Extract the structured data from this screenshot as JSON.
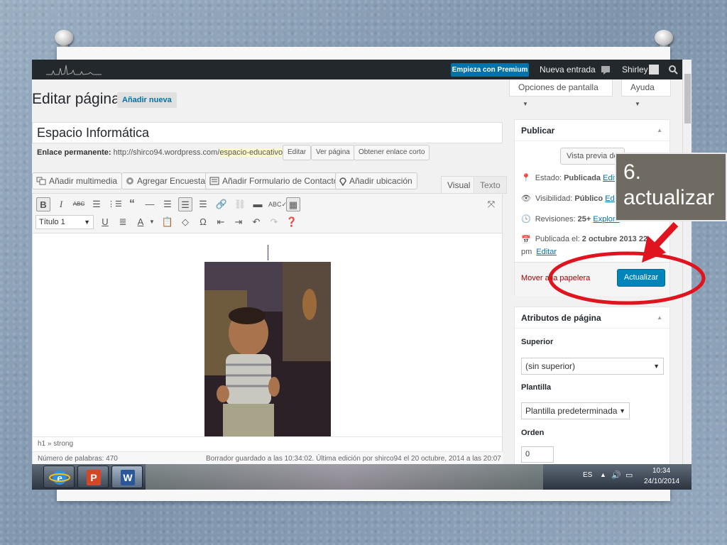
{
  "admin_bar": {
    "premium_button": "Empieza con Premium",
    "new_entry": "Nueva entrada",
    "user": "Shirley"
  },
  "screen_options": {
    "options": "Opciones de pantalla",
    "help": "Ayuda"
  },
  "page_header": {
    "title": "Editar página",
    "add_new": "Añadir nueva"
  },
  "post": {
    "title": "Espacio Informática",
    "permalink_label": "Enlace permanente:",
    "permalink_base": "http://shirco94.wordpress.com/",
    "permalink_slug": "espacio-educativo/",
    "edit_btn": "Editar",
    "view_btn": "Ver página",
    "shortlink_btn": "Obtener enlace corto"
  },
  "media_buttons": {
    "add_media": "Añadir multimedia",
    "add_poll": "Agregar Encuesta",
    "add_contact_form": "Añadir Formulario de Contacto",
    "add_location": "Añadir ubicación"
  },
  "editor_tabs": {
    "visual": "Visual",
    "text": "Texto"
  },
  "toolbar": {
    "format": "Título 1"
  },
  "editor_status": {
    "path": "h1 » strong",
    "word_count": "Número de palabras: 470",
    "draft_saved": "Borrador guardado a las 10:34:02. Última edición por shirco94 el 20 octubre, 2014 a las 20:07"
  },
  "publish_box": {
    "title": "Publicar",
    "preview": "Vista previa de",
    "status_label": "Estado:",
    "status_value": "Publicada",
    "status_edit": "Editar",
    "visibility_label": "Visibilidad:",
    "visibility_value": "Público",
    "visibility_edit": "Edita",
    "revisions_label": "Revisiones:",
    "revisions_value": "25+",
    "revisions_link": "Explora",
    "published_label": "Publicada el:",
    "published_value": "2 octubre 2013 22:",
    "published_time": "pm",
    "published_edit": "Editar",
    "trash": "Mover a la papelera",
    "update": "Actualizar"
  },
  "attributes_box": {
    "title": "Atributos de página",
    "parent_label": "Superior",
    "parent_value": "(sin superior)",
    "template_label": "Plantilla",
    "template_value": "Plantilla predeterminada",
    "order_label": "Orden",
    "order_value": "0"
  },
  "taskbar": {
    "language": "ES",
    "time": "10:34",
    "date": "24/10/2014"
  },
  "annotation": {
    "line1": "6.",
    "line2": "actualizar"
  },
  "colors": {
    "accent": "#0073aa",
    "update_button": "#0085ba",
    "admin_bar": "#23282d",
    "annotation_red": "#e0141e",
    "callout_bg": "#6f6a62"
  }
}
